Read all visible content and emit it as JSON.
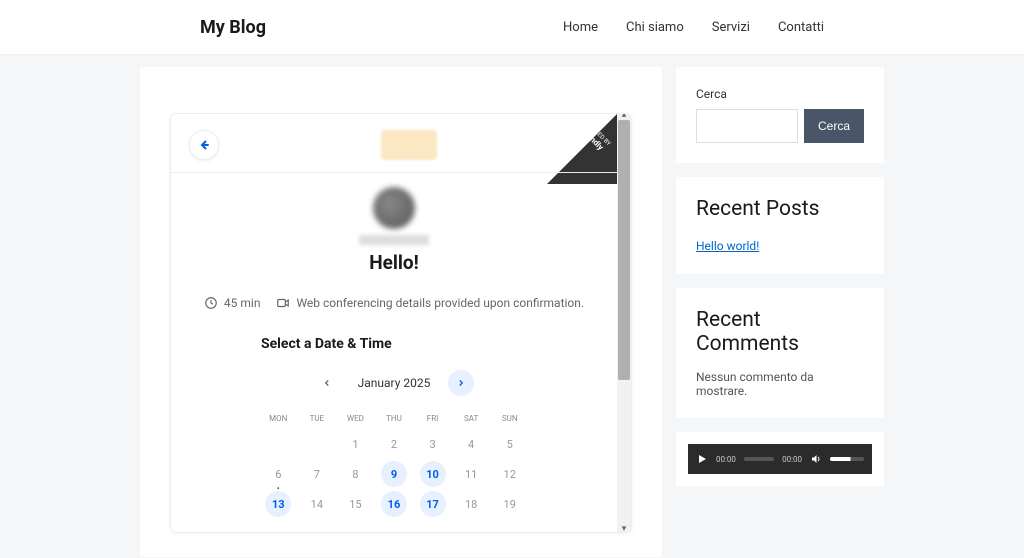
{
  "site": {
    "title": "My Blog"
  },
  "nav": {
    "items": [
      "Home",
      "Chi siamo",
      "Servizi",
      "Contatti"
    ]
  },
  "calendly": {
    "ribbon_powered": "POWERED BY",
    "ribbon_brand": "Calendly",
    "title": "Hello!",
    "duration": "45 min",
    "conferencing": "Web conferencing details provided upon confirmation.",
    "select_label": "Select a Date & Time",
    "month": "January 2025",
    "dow": [
      "MON",
      "TUE",
      "WED",
      "THU",
      "FRI",
      "SAT",
      "SUN"
    ],
    "weeks": [
      [
        {
          "n": "",
          "a": false
        },
        {
          "n": "",
          "a": false
        },
        {
          "n": "1",
          "a": false
        },
        {
          "n": "2",
          "a": false
        },
        {
          "n": "3",
          "a": false
        },
        {
          "n": "4",
          "a": false
        },
        {
          "n": "5",
          "a": false
        }
      ],
      [
        {
          "n": "6",
          "a": false,
          "dot": true
        },
        {
          "n": "7",
          "a": false
        },
        {
          "n": "8",
          "a": false
        },
        {
          "n": "9",
          "a": true
        },
        {
          "n": "10",
          "a": true
        },
        {
          "n": "11",
          "a": false
        },
        {
          "n": "12",
          "a": false
        }
      ],
      [
        {
          "n": "13",
          "a": true
        },
        {
          "n": "14",
          "a": false
        },
        {
          "n": "15",
          "a": false
        },
        {
          "n": "16",
          "a": true
        },
        {
          "n": "17",
          "a": true
        },
        {
          "n": "18",
          "a": false
        },
        {
          "n": "19",
          "a": false
        }
      ]
    ]
  },
  "sidebar": {
    "search_label": "Cerca",
    "search_button": "Cerca",
    "recent_posts_title": "Recent Posts",
    "recent_posts": [
      "Hello world!"
    ],
    "recent_comments_title": "Recent Comments",
    "recent_comments_empty": "Nessun commento da mostrare.",
    "audio": {
      "current": "00:00",
      "total": "00:00"
    }
  }
}
